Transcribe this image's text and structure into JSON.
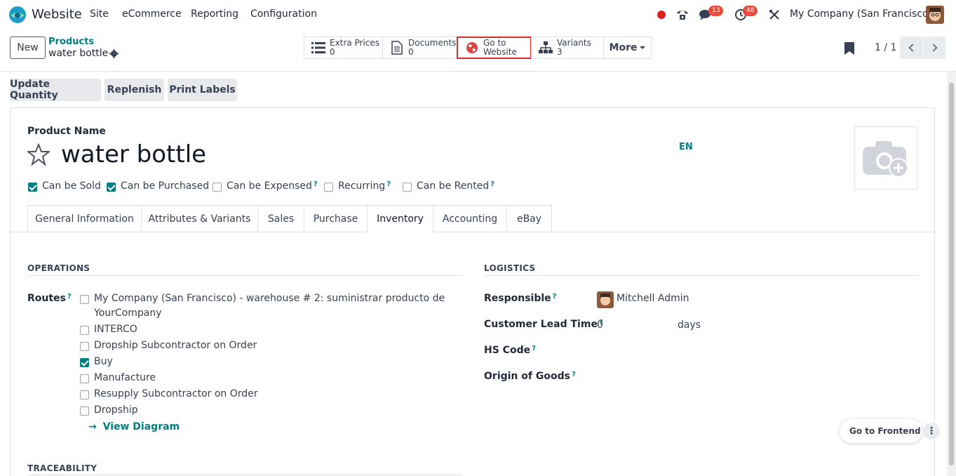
{
  "app": {
    "name": "Website"
  },
  "topnav": {
    "menus": [
      "Site",
      "eCommerce",
      "Reporting",
      "Configuration"
    ],
    "messages_count": "13",
    "activities_count": "48",
    "company": "My Company (San Francisco)"
  },
  "control_panel": {
    "new_label": "New",
    "breadcrumb_parent": "Products",
    "breadcrumb_current": "water bottle",
    "stat_buttons": [
      {
        "label": "Extra Prices",
        "value": "0",
        "icon": "list-icon"
      },
      {
        "label": "Documents",
        "value": "0",
        "icon": "document-icon"
      },
      {
        "label": "Go to",
        "value": "Website",
        "icon": "globe-icon"
      },
      {
        "label": "Variants",
        "value": "3",
        "icon": "sitemap-icon"
      }
    ],
    "more_label": "More",
    "pager": "1 / 1"
  },
  "actions": [
    "Update Quantity",
    "Replenish",
    "Print Labels"
  ],
  "form": {
    "product_name_label": "Product Name",
    "product_name": "water bottle",
    "lang": "EN",
    "options": [
      {
        "label": "Can be Sold",
        "checked": true,
        "help": false
      },
      {
        "label": "Can be Purchased",
        "checked": true,
        "help": false
      },
      {
        "label": "Can be Expensed",
        "checked": false,
        "help": true
      },
      {
        "label": "Recurring",
        "checked": false,
        "help": true
      },
      {
        "label": "Can be Rented",
        "checked": false,
        "help": true
      }
    ],
    "tabs": [
      "General Information",
      "Attributes & Variants",
      "Sales",
      "Purchase",
      "Inventory",
      "Accounting",
      "eBay"
    ],
    "active_tab": "Inventory"
  },
  "operations": {
    "title": "OPERATIONS",
    "routes_label": "Routes",
    "routes": [
      {
        "label": "My Company (San Francisco) - warehouse # 2: suministrar producto de",
        "label2": "YourCompany",
        "checked": false
      },
      {
        "label": "INTERCO",
        "checked": false
      },
      {
        "label": "Dropship Subcontractor on Order",
        "checked": false
      },
      {
        "label": "Buy",
        "checked": true
      },
      {
        "label": "Manufacture",
        "checked": false
      },
      {
        "label": "Resupply Subcontractor on Order",
        "checked": false
      },
      {
        "label": "Dropship",
        "checked": false
      }
    ],
    "view_diagram": "View Diagram"
  },
  "logistics": {
    "title": "LOGISTICS",
    "responsible_label": "Responsible",
    "responsible": "Mitchell Admin",
    "lead_time_label": "Customer Lead Time",
    "lead_time": "0",
    "lead_time_unit": "days",
    "hs_code_label": "HS Code",
    "origin_label": "Origin of Goods"
  },
  "traceability": {
    "title": "TRACEABILITY"
  },
  "frontend": {
    "label": "Go to Frontend"
  },
  "colors": {
    "accent": "#017e84",
    "brand": "#714b67",
    "badge": "#e74c3c",
    "highlight": "#d32f2f"
  }
}
